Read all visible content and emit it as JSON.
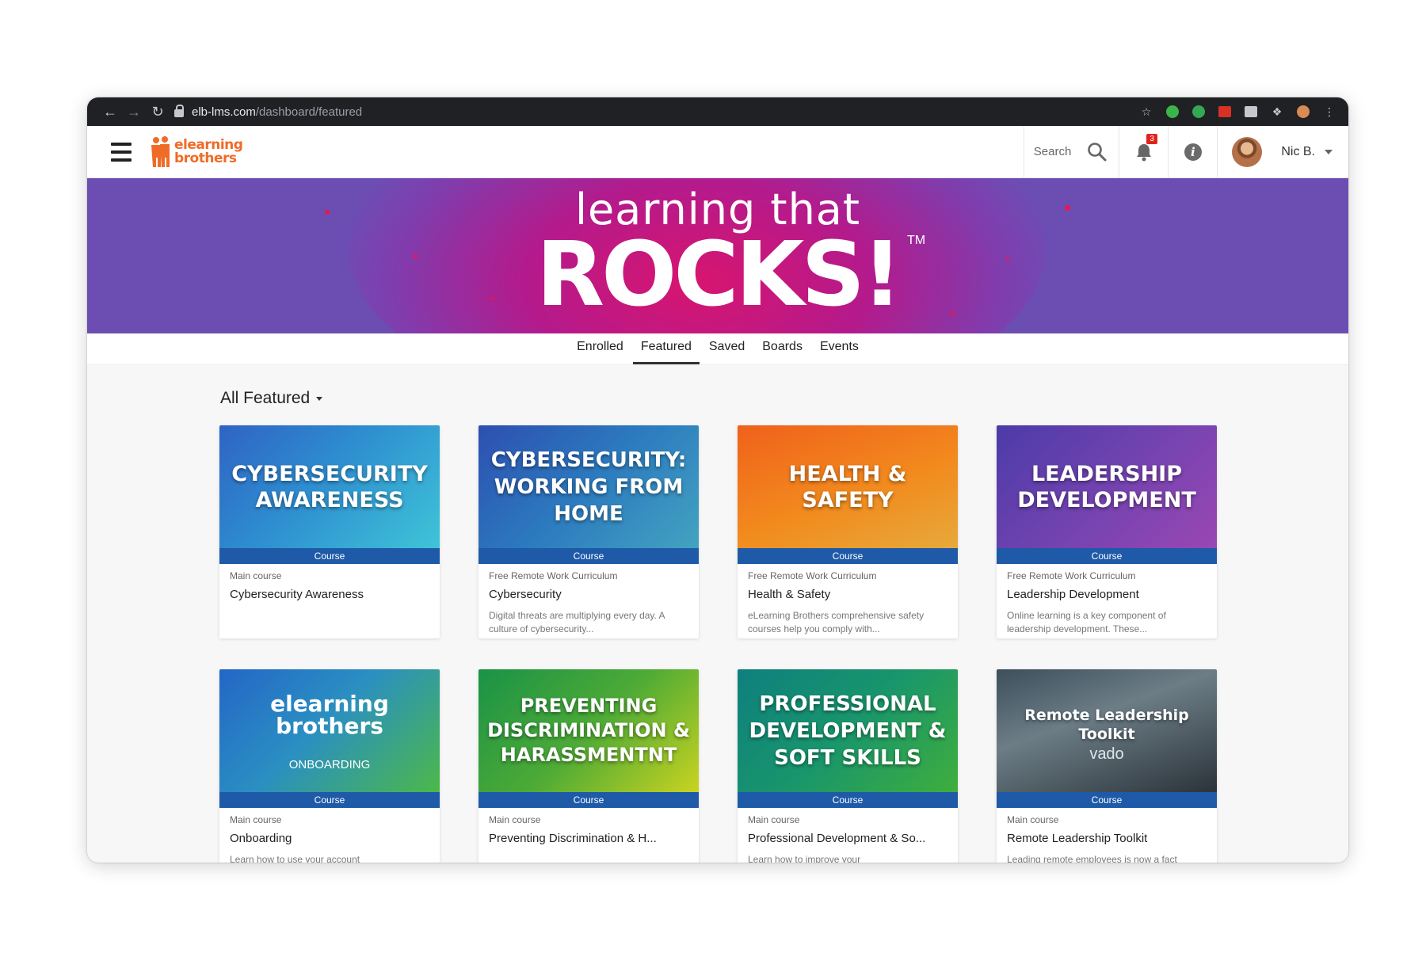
{
  "browser": {
    "url_host": "elb-lms.com",
    "url_path": "/dashboard/featured"
  },
  "header": {
    "logo_line1": "elearning",
    "logo_line2": "brothers",
    "search_label": "Search",
    "notification_count": "3",
    "user_name": "Nic B."
  },
  "hero": {
    "line1": "learning that",
    "line2": "ROCKS!",
    "tm": "TM"
  },
  "tabs": [
    "Enrolled",
    "Featured",
    "Saved",
    "Boards",
    "Events"
  ],
  "active_tab": "Featured",
  "filter_label": "All Featured",
  "cards": [
    {
      "thumb_title": "CYBERSECURITY AWARENESS",
      "ribbon": "Course",
      "category": "Main course",
      "name": "Cybersecurity Awareness",
      "desc": ""
    },
    {
      "thumb_title": "CYBERSECURITY: WORKING FROM HOME",
      "ribbon": "Course",
      "category": "Free Remote Work Curriculum",
      "name": "Cybersecurity",
      "desc": "Digital threats are multiplying every day. A culture of cybersecurity..."
    },
    {
      "thumb_title": "HEALTH & SAFETY",
      "ribbon": "Course",
      "category": "Free Remote Work Curriculum",
      "name": "Health & Safety",
      "desc": "eLearning Brothers comprehensive safety courses help you comply with..."
    },
    {
      "thumb_title": "LEADERSHIP DEVELOPMENT",
      "ribbon": "Course",
      "category": "Free Remote Work Curriculum",
      "name": "Leadership Development",
      "desc": "Online learning is a key component of leadership development. These..."
    },
    {
      "thumb_logo1": "elearning",
      "thumb_logo2": "brothers",
      "thumb_sub": "ONBOARDING",
      "ribbon": "Course",
      "category": "Main course",
      "name": "Onboarding",
      "desc": "Learn how to use your account"
    },
    {
      "thumb_title": "PREVENTING DISCRIMINATION & HARASSMENTNT",
      "ribbon": "Course",
      "category": "Main course",
      "name": "Preventing Discrimination & H...",
      "desc": ""
    },
    {
      "thumb_title": "PROFESSIONAL DEVELOPMENT & SOFT SKILLS",
      "ribbon": "Course",
      "category": "Main course",
      "name": "Professional Development & So...",
      "desc": "Learn how to improve your"
    },
    {
      "thumb_title": "Remote Leadership Toolkit",
      "thumb_sub": "vado",
      "ribbon": "Course",
      "category": "Main course",
      "name": "Remote Leadership Toolkit",
      "desc": "Leading remote employees is now a fact"
    }
  ],
  "colors": {
    "brand_orange": "#f06b26",
    "hero_purple": "#6c4eb3",
    "ribbon_blue": "#1e5aa8",
    "badge_red": "#e0231c"
  }
}
